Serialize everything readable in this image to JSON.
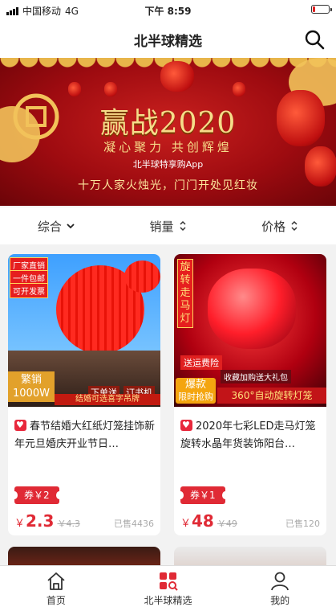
{
  "status": {
    "carrier": "中国移动",
    "network": "4G",
    "time": "下午 8:59",
    "battery_level": 0.18
  },
  "header": {
    "title": "北半球精选"
  },
  "banner": {
    "headline": "赢战2020",
    "slogan": "凝心聚力 共创辉煌",
    "app": "北半球特享购App",
    "tagline": "十万人家火烛光，门门开处见红妆"
  },
  "sort": [
    {
      "label": "综合",
      "icon": "chevron-down-icon"
    },
    {
      "label": "销量",
      "icon": "sort-updown-icon"
    },
    {
      "label": "价格",
      "icon": "sort-updown-icon"
    }
  ],
  "products": [
    {
      "badges": [
        "厂家直销",
        "一件包邮",
        "可开发票"
      ],
      "image_text": [
        "繁销",
        "1000W",
        "下单送",
        "订书机",
        "结婚可选喜字吊牌"
      ],
      "title": "春节结婚大红纸灯笼挂饰新年元旦婚庆开业节日…",
      "coupon": "券￥2",
      "currency": "￥",
      "price": "2.3",
      "original_price": "￥4.3",
      "sold": "已售4436"
    },
    {
      "badges": [
        "旋转走马灯"
      ],
      "image_text": [
        "送运费险",
        "收藏加购送大礼包",
        "爆款",
        "限时抢购",
        "360°自动旋转灯笼"
      ],
      "title": "2020年七彩LED走马灯笼旋转水晶年货装饰阳台…",
      "coupon": "券￥1",
      "currency": "￥",
      "price": "48",
      "original_price": "￥49",
      "sold": "已售120"
    }
  ],
  "tabbar": [
    {
      "label": "首页",
      "icon": "home-icon"
    },
    {
      "label": "北半球精选",
      "icon": "selection-grid-icon"
    },
    {
      "label": "我的",
      "icon": "user-icon"
    }
  ],
  "colors": {
    "accent": "#e02a35",
    "banner_red": "#9e0b10",
    "gold": "#f6dc8a"
  }
}
